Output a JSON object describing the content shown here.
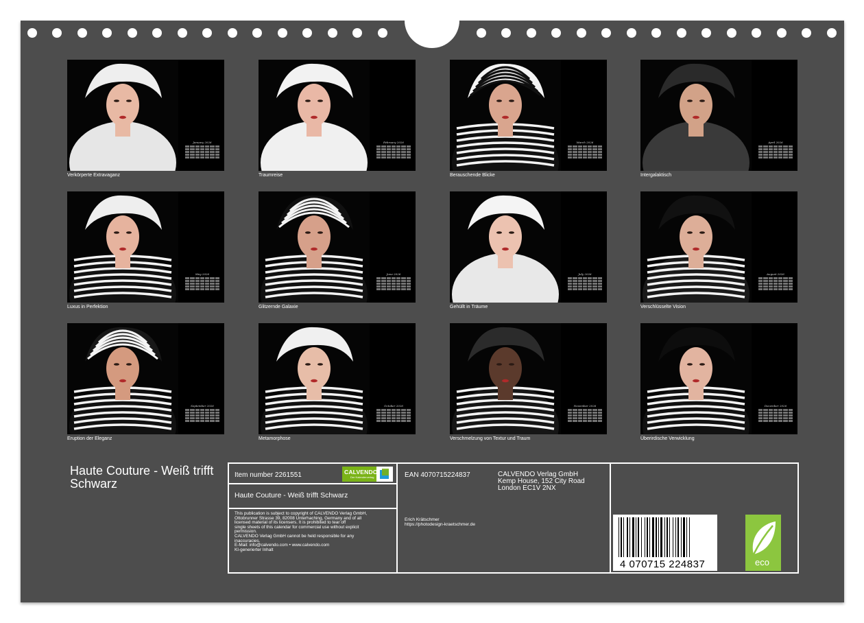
{
  "months": [
    {
      "name": "January 2026",
      "caption": "Verkörperte Extravaganz"
    },
    {
      "name": "February 2026",
      "caption": "Traumreise"
    },
    {
      "name": "March 2026",
      "caption": "Berauschende Blicke"
    },
    {
      "name": "April 2026",
      "caption": "Intergalaktisch"
    },
    {
      "name": "May 2026",
      "caption": "Luxus in Perfektion"
    },
    {
      "name": "June 2026",
      "caption": "Glitzernde Galaxie"
    },
    {
      "name": "July 2026",
      "caption": "Gehüllt in Träume"
    },
    {
      "name": "August 2026",
      "caption": "Verschlüsselte Vision"
    },
    {
      "name": "September 2026",
      "caption": "Eruption der Eleganz"
    },
    {
      "name": "October 2026",
      "caption": "Metamorphose"
    },
    {
      "name": "November 2026",
      "caption": "Verschmelzung von Textur und Traum"
    },
    {
      "name": "December 2026",
      "caption": "Überirdische Verwicklung"
    }
  ],
  "product": {
    "title": "Haute Couture - Weiß trifft Schwarz",
    "item_number": "Item number 2261551",
    "box_title": "Haute Couture - Weiß trifft Schwarz",
    "ean": "EAN 4070715224837",
    "barcode_digits": "4 070715 224837",
    "logo_text": "CALVENDO",
    "logo_subtext": "Der Kalenderverlag",
    "eco_label": "eco"
  },
  "legal_lines": [
    "This publication is subject to copyright of CALVENDO Verlag GmbH,",
    "Ottobrunner Strasse 39, 82008 Unterhaching, Germany and of all",
    "licensed material of its licensers. It is prohibited to tear off",
    "single sheets of this calendar for commercial use without explicit",
    "permission.",
    "CALVENDO Verlag GmbH cannot be held responsible for any",
    "inaccuracies.",
    "E-Mail: info@calvendo.com • www.calvendo.com",
    "KI-generierter Inhalt"
  ],
  "publisher": {
    "name": "CALVENDO Verlag GmbH",
    "address1": "Kemp House, 152 City Road",
    "address2": "London EC1V 2NX"
  },
  "author": {
    "name": "Erich Krätschmer",
    "url": "https://photodesign-kraetschmer.de"
  },
  "colors": {
    "board": "#4d4d4d",
    "eco_green": "#8cc63f",
    "logo_green": "#7ab317"
  }
}
